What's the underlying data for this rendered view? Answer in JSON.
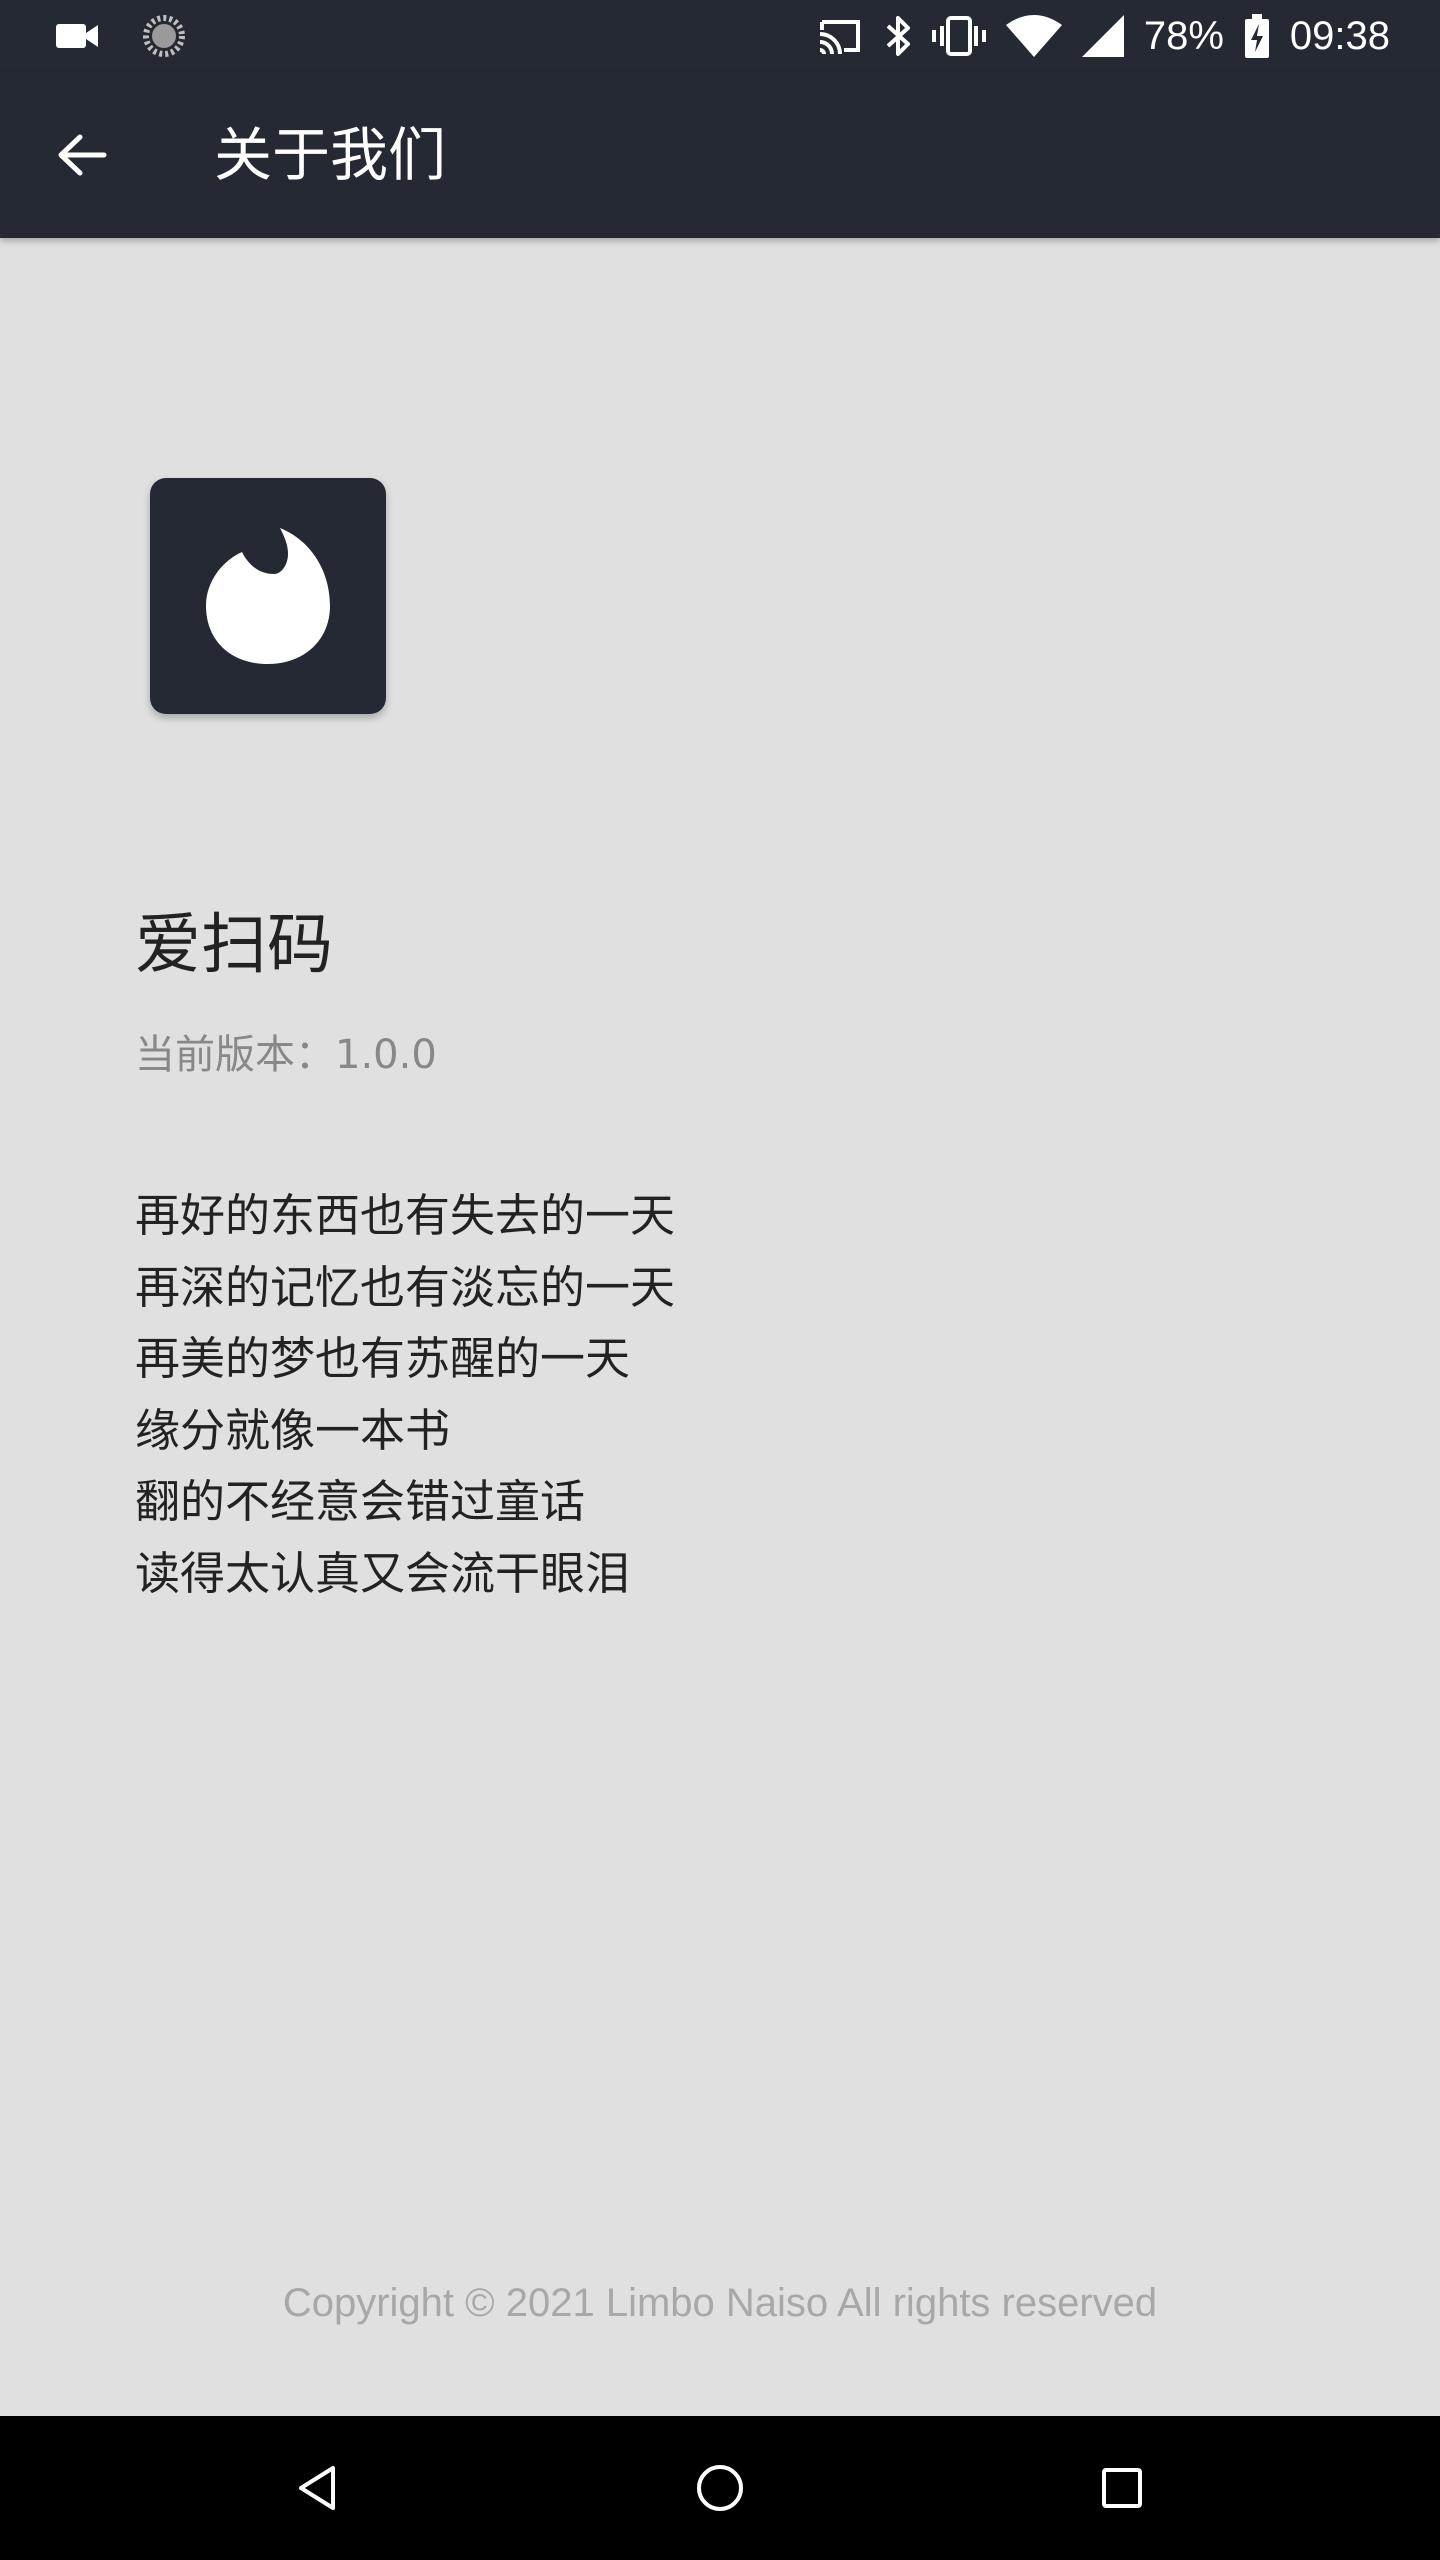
{
  "status_bar": {
    "battery": "78%",
    "time": "09:38",
    "icons": [
      "video-camera-icon",
      "sync-icon",
      "cast-icon",
      "bluetooth-icon",
      "vibrate-icon",
      "wifi-icon",
      "signal-icon",
      "battery-charging-icon"
    ]
  },
  "app_bar": {
    "title": "关于我们",
    "back_icon": "arrow-left-icon"
  },
  "about": {
    "logo_icon": "flame-icon",
    "app_name": "爱扫码",
    "version": "当前版本：1.0.0",
    "poem": [
      "再好的东西也有失去的一天",
      "再深的记忆也有淡忘的一天",
      "再美的梦也有苏醒的一天",
      "缘分就像一本书",
      "翻的不经意会错过童话",
      "读得太认真又会流干眼泪"
    ],
    "copyright": "Copyright © 2021 Limbo Naiso All rights reserved"
  },
  "nav_bar": {
    "icons": [
      "back-triangle-icon",
      "home-circle-icon",
      "recents-square-icon"
    ]
  },
  "colors": {
    "app_bar": "#252933",
    "background": "#e0e0e0",
    "primary_text": "#222222",
    "secondary_text": "#888888",
    "copyright_text": "#a8a8a8"
  }
}
